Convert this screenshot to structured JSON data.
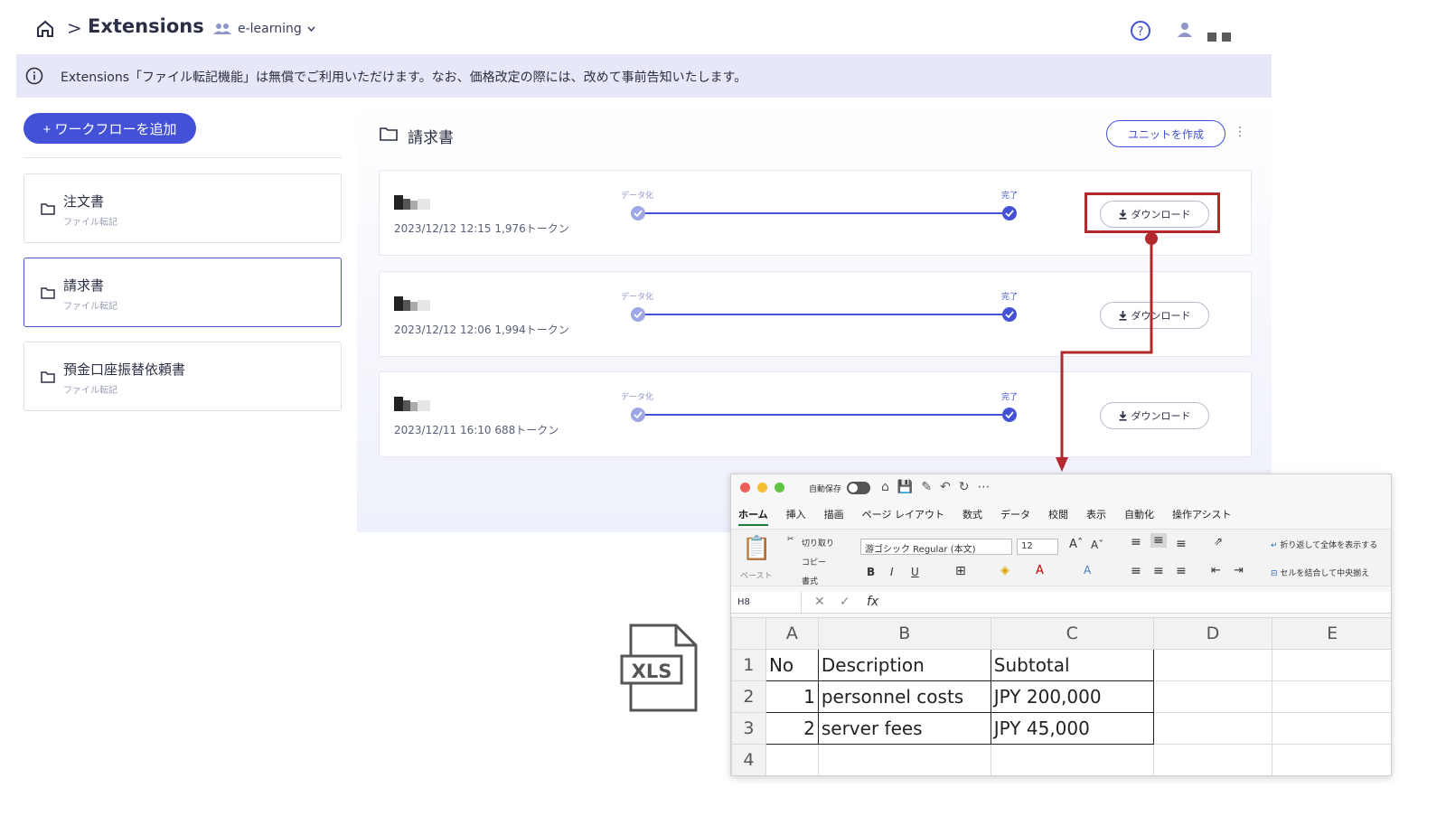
{
  "app": {
    "breadcrumb_sep": ">",
    "title": "Extensions",
    "workspace": "e-learning",
    "notice": "Extensions「ファイル転記機能」は無償でご利用いただけます。なお、価格改定の際には、改めて事前告知いたします。"
  },
  "sidebar": {
    "add_label": "+ ワークフローを追加",
    "items": [
      {
        "title": "注文書",
        "subtitle": "ファイル転記"
      },
      {
        "title": "請求書",
        "subtitle": "ファイル転記"
      },
      {
        "title": "預金口座振替依頼書",
        "subtitle": "ファイル転記"
      }
    ]
  },
  "main": {
    "title": "請求書",
    "create_unit_label": "ユニットを作成",
    "stage_start": "データ化",
    "stage_end": "完了",
    "download_label": "ダウンロード",
    "jobs": [
      {
        "meta": "2023/12/12 12:15   1,976トークン"
      },
      {
        "meta": "2023/12/12 12:06   1,994トークン"
      },
      {
        "meta": "2023/12/11 16:10   688トークン"
      }
    ]
  },
  "file_icon": {
    "label": "XLS"
  },
  "excel": {
    "autosave_label": "自動保存",
    "tabs": [
      "ホーム",
      "挿入",
      "描画",
      "ページ レイアウト",
      "数式",
      "データ",
      "校閲",
      "表示",
      "自動化",
      "操作アシスト"
    ],
    "ribbon": {
      "paste": "ペースト",
      "cut": "切り取り",
      "copy": "コピー",
      "format": "書式",
      "font": "游ゴシック Regular (本文)",
      "size": "12",
      "wrap": "折り返して全体を表示する",
      "merge": "セルを結合して中央揃え"
    },
    "namebox": "H8",
    "columns": [
      "A",
      "B",
      "C",
      "D",
      "E"
    ],
    "rows": [
      {
        "n": "1",
        "a": "No",
        "b": "Description",
        "c": "Subtotal"
      },
      {
        "n": "2",
        "a": "1",
        "b": "personnel costs",
        "c": "JPY 200,000"
      },
      {
        "n": "3",
        "a": "2",
        "b": "server fees",
        "c": "JPY 45,000"
      },
      {
        "n": "4",
        "a": "",
        "b": "",
        "c": ""
      }
    ]
  },
  "colors": {
    "accent": "#4251d6",
    "highlight": "#b3282d",
    "notice_bg": "#e6e8f7"
  }
}
